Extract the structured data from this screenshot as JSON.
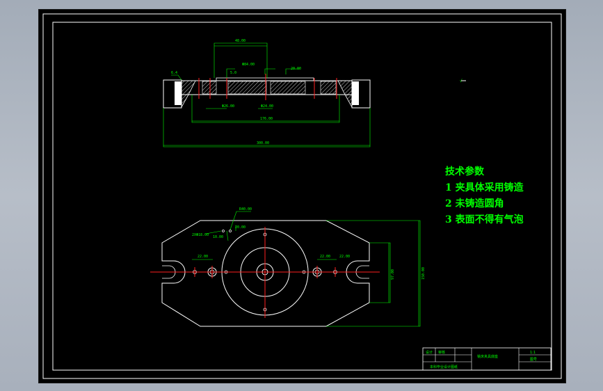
{
  "drawing": {
    "tech_title": "技术参数",
    "tech_notes": [
      "1 夹具体采用铸造",
      "2 未铸造圆角",
      "3 表面不得有气泡"
    ],
    "roughness_mark": "√",
    "dimensions": {
      "top_width": "48.00",
      "top_small": "5.0",
      "top_mid": "Φ84.00",
      "top_right": "20.00",
      "left_angle": "6.4",
      "bottom_left": "Φ26.00",
      "bottom_mid": "Φ24.00",
      "lower_span": "176.00",
      "overall": "300.00",
      "plan_r": "R40.00",
      "plan_hole": "2XΦ18.00",
      "plan_a": "10.00",
      "plan_b": "20.00",
      "plan_left": "22.00",
      "plan_right1": "22.00",
      "plan_right2": "22.00",
      "plan_height": "97.00",
      "plan_overall": "150.00"
    }
  },
  "title_block": {
    "cell1": "设计",
    "cell2": "审核",
    "drawing_name": "铣床夹具底座",
    "scale": "1:1",
    "sheet": "图号",
    "school": "本科毕业设计图纸"
  }
}
